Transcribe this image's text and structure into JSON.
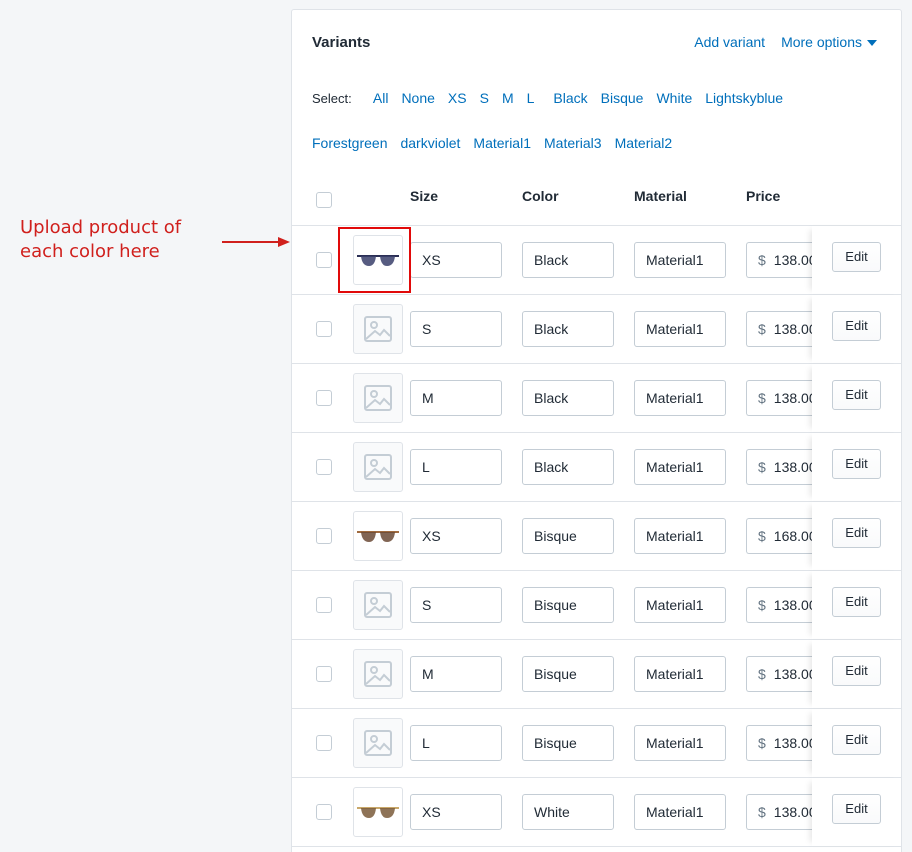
{
  "annotation": {
    "line1": "Upload product of",
    "line2": "each color here"
  },
  "card": {
    "title": "Variants",
    "add_variant": "Add variant",
    "more_options": "More options"
  },
  "select": {
    "label": "Select:",
    "options": [
      "All",
      "None",
      "XS",
      "S",
      "M",
      "L",
      "Black",
      "Bisque",
      "White",
      "Lightskyblue",
      "Forestgreen",
      "darkviolet",
      "Material1",
      "Material3",
      "Material2"
    ]
  },
  "table": {
    "headers": {
      "size": "Size",
      "color": "Color",
      "material": "Material",
      "price": "Price"
    },
    "currency": "$",
    "edit_label": "Edit",
    "rows": [
      {
        "size": "XS",
        "color": "Black",
        "material": "Material1",
        "price": "138.00",
        "image": "dark-sunglasses-icon"
      },
      {
        "size": "S",
        "color": "Black",
        "material": "Material1",
        "price": "138.00",
        "image": "image-placeholder-icon"
      },
      {
        "size": "M",
        "color": "Black",
        "material": "Material1",
        "price": "138.00",
        "image": "image-placeholder-icon"
      },
      {
        "size": "L",
        "color": "Black",
        "material": "Material1",
        "price": "138.00",
        "image": "image-placeholder-icon"
      },
      {
        "size": "XS",
        "color": "Bisque",
        "material": "Material1",
        "price": "168.00",
        "image": "tortoise-sunglasses-icon"
      },
      {
        "size": "S",
        "color": "Bisque",
        "material": "Material1",
        "price": "138.00",
        "image": "image-placeholder-icon"
      },
      {
        "size": "M",
        "color": "Bisque",
        "material": "Material1",
        "price": "138.00",
        "image": "image-placeholder-icon"
      },
      {
        "size": "L",
        "color": "Bisque",
        "material": "Material1",
        "price": "138.00",
        "image": "image-placeholder-icon"
      },
      {
        "size": "XS",
        "color": "White",
        "material": "Material1",
        "price": "138.00",
        "image": "gold-aviator-sunglasses-icon"
      }
    ]
  },
  "colors": {
    "accent": "#006fbb",
    "annotation": "#d0201d",
    "border": "#dfe3e8"
  }
}
